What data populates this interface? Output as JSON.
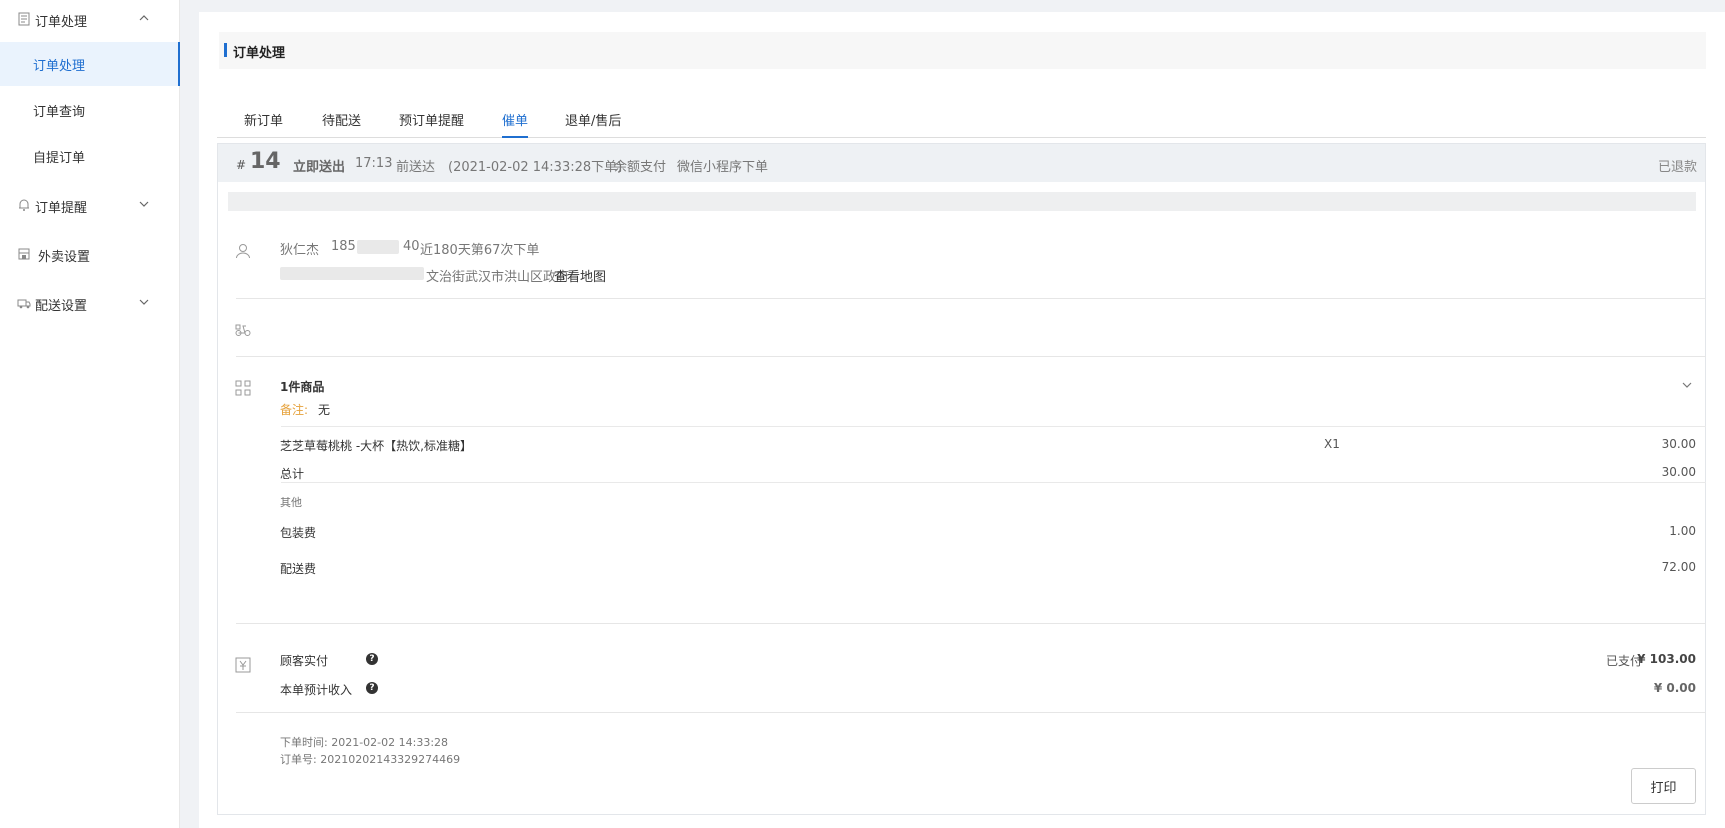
{
  "sidebar": {
    "groups": [
      {
        "label": "订单处理",
        "icon": "document-icon",
        "expanded": true
      },
      {
        "label": "订单提醒",
        "icon": "bell-icon",
        "expanded": false
      },
      {
        "label": "外卖设置",
        "icon": "store-icon"
      },
      {
        "label": "配送设置",
        "icon": "delivery-icon",
        "expanded": false
      }
    ],
    "items": [
      {
        "label": "订单处理",
        "active": true
      },
      {
        "label": "订单查询",
        "active": false
      },
      {
        "label": "自提订单",
        "active": false
      }
    ]
  },
  "page": {
    "title": "订单处理"
  },
  "tabs": [
    {
      "label": "新订单",
      "active": false
    },
    {
      "label": "待配送",
      "active": false
    },
    {
      "label": "预订单提醒",
      "active": false
    },
    {
      "label": "催单",
      "active": true
    },
    {
      "label": "退单/售后",
      "active": false
    }
  ],
  "order": {
    "hash": "#",
    "number": "14",
    "delivery_type": "立即送出",
    "delivery_time": "17:13",
    "arrive_text": "前送达",
    "created_paren": "(2021-02-02 14:33:28下单)",
    "payment": "余额支付",
    "channel": "微信小程序下单",
    "status": "已退款",
    "customer": {
      "name": "狄仁杰",
      "phone_start": "185",
      "phone_end": "40",
      "history": "近180天第67次下单",
      "address_tail": "文治街武汉市洪山区政府",
      "map_link": "查看地图"
    },
    "goods": {
      "count_label": "1件商品",
      "remark_label": "备注:",
      "remark_value": "无",
      "items": [
        {
          "name": "芝芝草莓桃桃 -大杯【热饮,标准糖】",
          "qty": "X1",
          "price": "30.00"
        }
      ],
      "total_label": "总计",
      "total_value": "30.00",
      "other_label": "其他",
      "packing_label": "包装费",
      "packing_value": "1.00",
      "delivery_fee_label": "配送费",
      "delivery_fee_value": "72.00"
    },
    "payment_info": {
      "paid_label": "顾客实付",
      "paid_status": "已支付",
      "paid_value": "¥ 103.00",
      "income_label": "本单预计收入",
      "income_value": "¥ 0.00"
    },
    "footer": {
      "time_label": "下单时间: 2021-02-02 14:33:28",
      "order_no_label": "订单号: 20210202143329274469",
      "print_label": "打印"
    }
  },
  "colors": {
    "accent": "#1f6fd0",
    "remark": "#e6a23c"
  }
}
